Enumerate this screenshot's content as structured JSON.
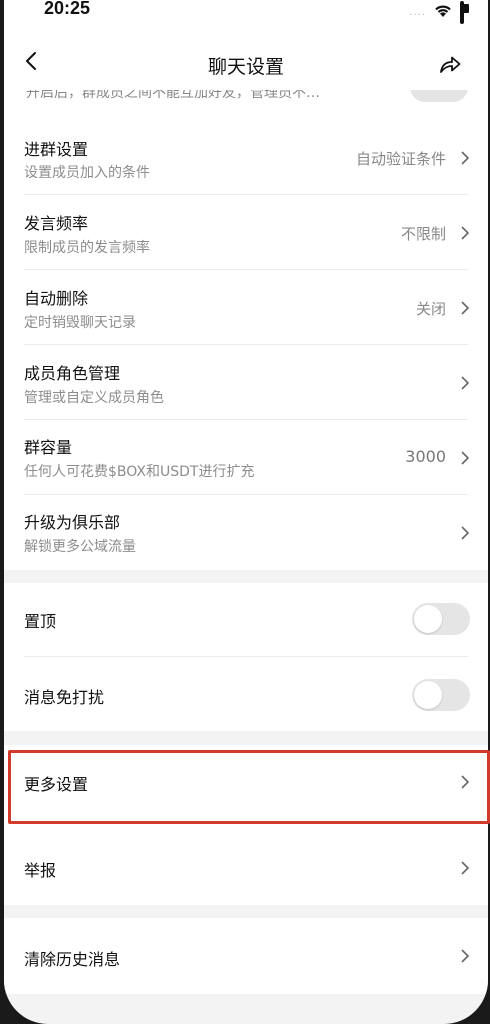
{
  "status_bar": {
    "time": "20:25",
    "signal_dots": "....",
    "icons": [
      "wifi-icon",
      "battery-icon"
    ]
  },
  "nav": {
    "title": "聊天设置",
    "back_icon": "chevron-left-icon",
    "share_icon": "share-icon"
  },
  "partial_row": {
    "text": "开启后，群成员之间不能互加好友，管理员不…"
  },
  "settings": [
    {
      "title": "进群设置",
      "subtitle": "设置成员加入的条件",
      "value": "自动验证条件"
    },
    {
      "title": "发言频率",
      "subtitle": "限制成员的发言频率",
      "value": "不限制"
    },
    {
      "title": "自动删除",
      "subtitle": "定时销毁聊天记录",
      "value": "关闭"
    },
    {
      "title": "成员角色管理",
      "subtitle": "管理或自定义成员角色",
      "value": ""
    },
    {
      "title": "群容量",
      "subtitle": "任何人可花费$BOX和USDT进行扩充",
      "value": "3000"
    },
    {
      "title": "升级为俱乐部",
      "subtitle": "解锁更多公域流量",
      "value": ""
    }
  ],
  "toggles": [
    {
      "label": "置顶",
      "on": false
    },
    {
      "label": "消息免打扰",
      "on": false
    }
  ],
  "more_settings": {
    "label": "更多设置"
  },
  "report": {
    "label": "举报"
  },
  "clear_history": {
    "label": "清除历史消息"
  },
  "colors": {
    "highlight": "#d23b2a",
    "background": "#f3f3f3",
    "card": "#ffffff"
  }
}
